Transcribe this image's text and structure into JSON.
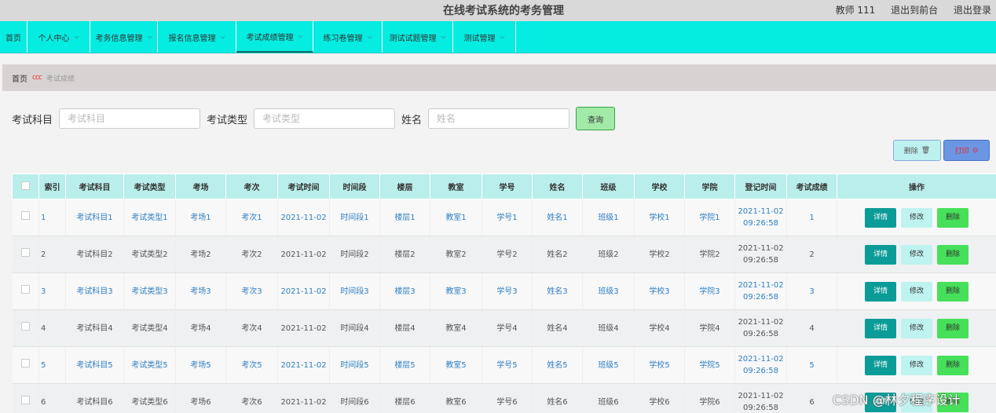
{
  "header": {
    "title": "在线考试系统的考务管理",
    "user_role": "教师 111",
    "back_front": "退出到前台",
    "logout": "退出登录"
  },
  "nav": [
    {
      "label": "首页",
      "dropdown": false
    },
    {
      "label": "个人中心",
      "dropdown": true
    },
    {
      "label": "考务信息管理",
      "dropdown": true
    },
    {
      "label": "报名信息管理",
      "dropdown": true
    },
    {
      "label": "考试成绩管理",
      "dropdown": true,
      "active": true
    },
    {
      "label": "练习卷管理",
      "dropdown": true
    },
    {
      "label": "测试试题管理",
      "dropdown": true
    },
    {
      "label": "测试管理",
      "dropdown": true
    }
  ],
  "breadcrumb": {
    "home": "首页",
    "separator": "ccc",
    "current": "考试成绩"
  },
  "search": {
    "subject_label": "考试科目",
    "subject_placeholder": "考试科目",
    "type_label": "考试类型",
    "type_placeholder": "考试类型",
    "name_label": "姓名",
    "name_placeholder": "姓名",
    "query_button": "查询"
  },
  "actions": {
    "delete": "删除",
    "print": "打印"
  },
  "table": {
    "headers": [
      "",
      "索引",
      "考试科目",
      "考试类型",
      "考场",
      "考次",
      "考试时间",
      "时间段",
      "楼层",
      "教室",
      "学号",
      "姓名",
      "班级",
      "学校",
      "学院",
      "登记时间",
      "考试成绩",
      "操作"
    ],
    "row_buttons": {
      "detail": "详情",
      "edit": "修改",
      "delete": "删除"
    },
    "rows": [
      [
        "1",
        "考试科目1",
        "考试类型1",
        "考场1",
        "考次1",
        "2021-11-02",
        "时间段1",
        "楼层1",
        "教室1",
        "学号1",
        "姓名1",
        "班级1",
        "学校1",
        "学院1",
        "2021-11-02 09:26:58",
        "1"
      ],
      [
        "2",
        "考试科目2",
        "考试类型2",
        "考场2",
        "考次2",
        "2021-11-02",
        "时间段2",
        "楼层2",
        "教室2",
        "学号2",
        "姓名2",
        "班级2",
        "学校2",
        "学院2",
        "2021-11-02 09:26:58",
        "2"
      ],
      [
        "3",
        "考试科目3",
        "考试类型3",
        "考场3",
        "考次3",
        "2021-11-02",
        "时间段3",
        "楼层3",
        "教室3",
        "学号3",
        "姓名3",
        "班级3",
        "学校3",
        "学院3",
        "2021-11-02 09:26:58",
        "3"
      ],
      [
        "4",
        "考试科目4",
        "考试类型4",
        "考场4",
        "考次4",
        "2021-11-02",
        "时间段4",
        "楼层4",
        "教室4",
        "学号4",
        "姓名4",
        "班级4",
        "学校4",
        "学院4",
        "2021-11-02 09:26:58",
        "4"
      ],
      [
        "5",
        "考试科目5",
        "考试类型5",
        "考场5",
        "考次5",
        "2021-11-02",
        "时间段5",
        "楼层5",
        "教室5",
        "学号5",
        "姓名5",
        "班级5",
        "学校5",
        "学院5",
        "2021-11-02 09:26:58",
        "5"
      ],
      [
        "6",
        "考试科目6",
        "考试类型6",
        "考场6",
        "考次6",
        "2021-11-02",
        "时间段6",
        "楼层6",
        "教室6",
        "学号6",
        "姓名6",
        "班级6",
        "学校6",
        "学院6",
        "2021-11-02 09:26:58",
        "6"
      ]
    ]
  },
  "watermark": "CSDN @林夕程序设计"
}
